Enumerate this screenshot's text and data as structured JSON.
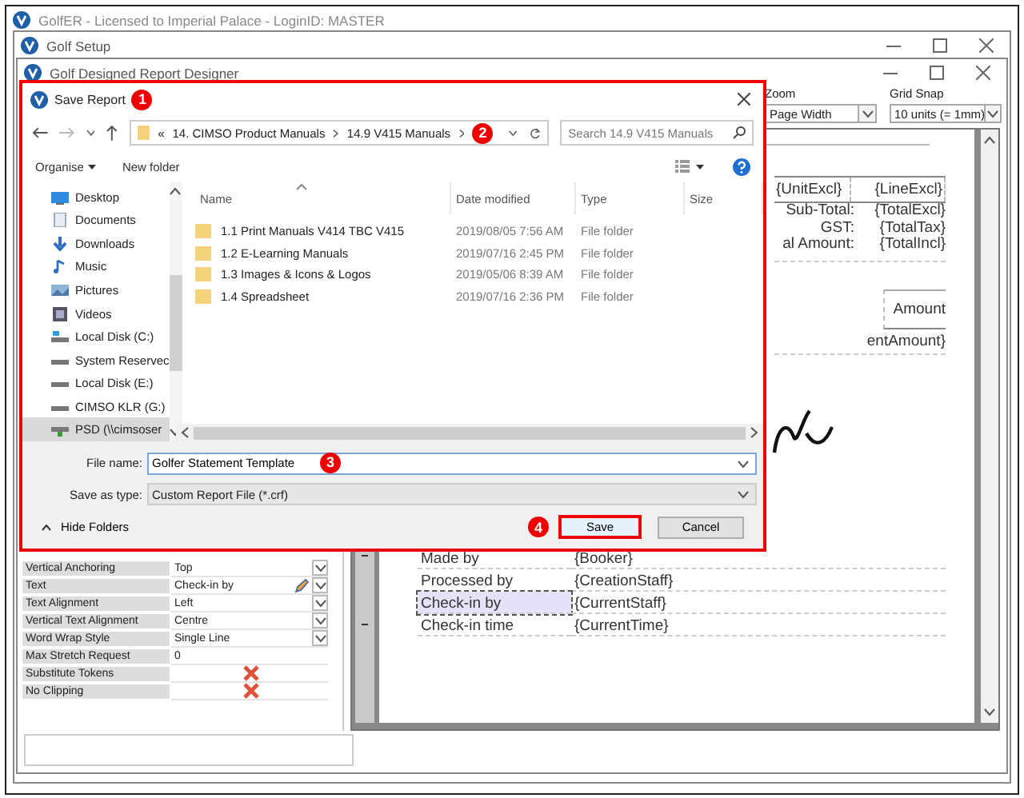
{
  "main_window": {
    "title": "GolfER - Licensed to Imperial Palace - LoginID: MASTER"
  },
  "setup_window": {
    "title": "Golf Setup"
  },
  "designer_window": {
    "title": "Golf Designed Report Designer",
    "zoom": {
      "label": "Zoom",
      "value": "Page Width"
    },
    "grid_snap": {
      "label": "Grid Snap",
      "value": "10 units (= 1mm)"
    },
    "properties": [
      {
        "name": "Vertical Anchoring",
        "value": "Top",
        "kind": "dropdown"
      },
      {
        "name": "Text",
        "value": "Check-in by",
        "kind": "editor"
      },
      {
        "name": "Text Alignment",
        "value": "Left",
        "kind": "dropdown"
      },
      {
        "name": "Vertical Text Alignment",
        "value": "Centre",
        "kind": "dropdown"
      },
      {
        "name": "Word Wrap Style",
        "value": "Single Line",
        "kind": "dropdown"
      },
      {
        "name": "Max Stretch Request",
        "value": "0",
        "kind": "plain"
      },
      {
        "name": "Substitute Tokens",
        "kind": "flag",
        "checked": false
      },
      {
        "name": "No Clipping",
        "kind": "flag",
        "checked": false
      }
    ],
    "report": {
      "line_item": [
        "{UnitExcl}",
        "{LineExcl}"
      ],
      "totals": [
        {
          "label": "Sub-Total:",
          "value": "{TotalExcl}"
        },
        {
          "label": "GST:",
          "value": "{TotalTax}"
        },
        {
          "label": "al Amount:",
          "value": "{TotalIncl}"
        }
      ],
      "payment_header": "Amount",
      "payment_value": "entAmount}",
      "footer_rows": [
        {
          "label": "Made by",
          "value": "{Booker}",
          "selected": false
        },
        {
          "label": "Processed by",
          "value": "{CreationStaff}",
          "selected": false
        },
        {
          "label": "Check-in by",
          "value": "{CurrentStaff}",
          "selected": true
        },
        {
          "label": "Check-in time",
          "value": "{CurrentTime}",
          "selected": false
        }
      ]
    }
  },
  "dialog": {
    "title": "Save Report",
    "callouts": [
      "1",
      "2",
      "3",
      "4"
    ],
    "path": {
      "prefix": "«",
      "segments": [
        "14. CIMSO Product Manuals",
        "14.9 V415 Manuals"
      ]
    },
    "search": {
      "placeholder": "Search 14.9 V415 Manuals"
    },
    "toolbar": {
      "organise": "Organise",
      "new_folder": "New folder"
    },
    "nav_items": [
      {
        "label": "Desktop",
        "kind": "desktop",
        "selected": false
      },
      {
        "label": "Documents",
        "kind": "documents",
        "selected": false
      },
      {
        "label": "Downloads",
        "kind": "downloads",
        "selected": false
      },
      {
        "label": "Music",
        "kind": "music",
        "selected": false
      },
      {
        "label": "Pictures",
        "kind": "pictures",
        "selected": false
      },
      {
        "label": "Videos",
        "kind": "videos",
        "selected": false
      },
      {
        "label": "Local Disk (C:)",
        "kind": "system-disk",
        "selected": false
      },
      {
        "label": "System Reservec",
        "kind": "disk",
        "selected": false
      },
      {
        "label": "Local Disk (E:)",
        "kind": "disk",
        "selected": false
      },
      {
        "label": "CIMSO KLR (G:)",
        "kind": "disk",
        "selected": false
      },
      {
        "label": "PSD (\\\\cimsoser",
        "kind": "network",
        "selected": true
      }
    ],
    "columns": [
      "Name",
      "Date modified",
      "Type",
      "Size"
    ],
    "files": [
      {
        "name": "1.1 Print Manuals V414 TBC V415",
        "date": "2019/08/05 7:56 AM",
        "type": "File folder"
      },
      {
        "name": "1.2 E-Learning Manuals",
        "date": "2019/07/16 2:45 PM",
        "type": "File folder"
      },
      {
        "name": "1.3 Images & Icons & Logos",
        "date": "2019/05/06 8:39 AM",
        "type": "File folder"
      },
      {
        "name": "1.4 Spreadsheet",
        "date": "2019/07/16 2:36 PM",
        "type": "File folder"
      }
    ],
    "file_name": {
      "label": "File name:",
      "value": "Golfer Statement Template"
    },
    "save_type": {
      "label": "Save as type:",
      "value": "Custom Report File (*.crf)"
    },
    "hide_folders": "Hide Folders",
    "buttons": [
      {
        "label": "Save",
        "kind": "primary"
      },
      {
        "label": "Cancel",
        "kind": "normal"
      }
    ]
  }
}
